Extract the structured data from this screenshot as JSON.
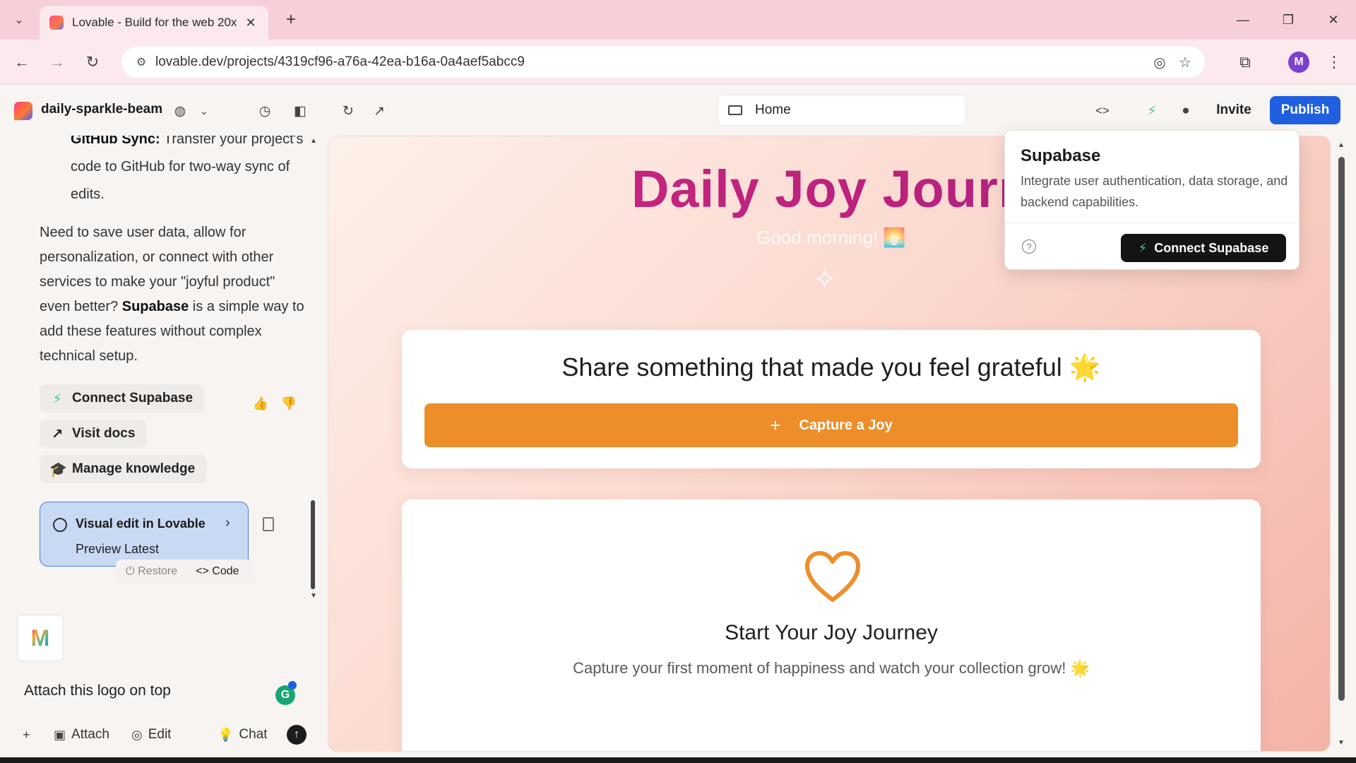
{
  "browser": {
    "tab_title": "Lovable - Build for the web 20x",
    "url": "lovable.dev/projects/4319cf96-a76a-42ea-b16a-0a4aef5abcc9",
    "profile_initial": "M"
  },
  "header": {
    "project_name": "daily-sparkle-beam",
    "route": "Home",
    "invite_label": "Invite",
    "publish_label": "Publish"
  },
  "chat": {
    "list_item_bold": "GitHub Sync:",
    "list_item_text": " Transfer your project's code to GitHub for two-way sync of edits.",
    "para_part1": "Need to save user data, allow for personalization, or connect with other services to make your \"joyful product\" even better? ",
    "para_bold": "Supabase",
    "para_part2": " is a simple way to add these features without complex technical setup.",
    "actions": {
      "connect_supabase": "Connect Supabase",
      "visit_docs": "Visit docs",
      "manage_knowledge": "Manage knowledge"
    },
    "visual_card": {
      "title": "Visual edit in Lovable",
      "subtitle": "Preview Latest",
      "restore": "Restore",
      "code": "Code"
    },
    "composer": {
      "attachment_logo": "M",
      "text": "Attach this logo on top",
      "attach_label": "Attach",
      "edit_label": "Edit",
      "chat_label": "Chat"
    }
  },
  "preview": {
    "hero_title": "Daily Joy Journ",
    "greeting": "Good morning! 🌅",
    "card1": {
      "title": "Share something that made you feel grateful 🌟",
      "button": "Capture a Joy"
    },
    "card2": {
      "title": "Start Your Joy Journey",
      "subtitle": "Capture your first moment of happiness and watch your collection grow! 🌟"
    }
  },
  "popover": {
    "title": "Supabase",
    "description": "Integrate user authentication, data storage, and backend capabilities.",
    "connect_label": "Connect Supabase"
  },
  "colors": {
    "publish": "#1f5fe0",
    "capture_button": "#ed8e2a",
    "hero_title": "#c2237e",
    "supabase_green": "#3ecf8e"
  }
}
